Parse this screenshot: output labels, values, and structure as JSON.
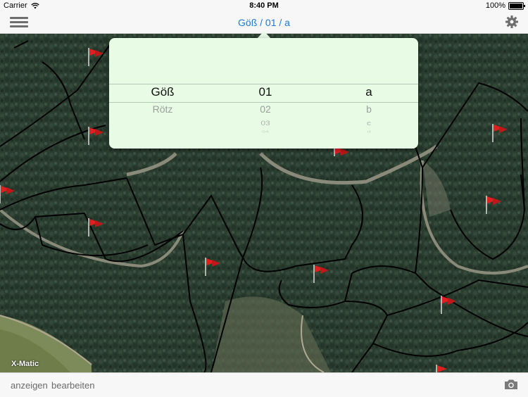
{
  "status": {
    "carrier": "Carrier",
    "time": "8:40 PM",
    "battery": "100%"
  },
  "nav": {
    "title": "Göß / 01 / a"
  },
  "picker": {
    "columns": [
      {
        "selected": "Göß",
        "items": [
          "Rötz"
        ]
      },
      {
        "selected": "01",
        "items": [
          "02",
          "03",
          "04"
        ]
      },
      {
        "selected": "a",
        "items": [
          "b",
          "c",
          "d"
        ]
      }
    ]
  },
  "map": {
    "watermark": "X-Matic",
    "flag_color": "#e02020"
  },
  "bottom": {
    "show_label": "anzeigen",
    "edit_label": "bearbeiten"
  },
  "colors": {
    "accent": "#1a7ae0",
    "popover_bg": "#e7fbe5"
  }
}
